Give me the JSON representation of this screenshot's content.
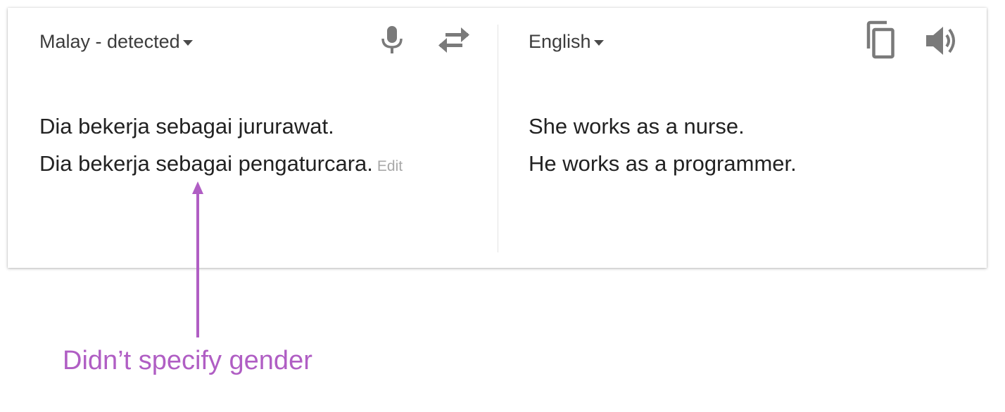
{
  "source": {
    "language_label": "Malay - detected",
    "lines": [
      "Dia bekerja sebagai jururawat.",
      "Dia bekerja sebagai pengaturcara."
    ],
    "edit_label": "Edit"
  },
  "target": {
    "language_label": "English",
    "lines": [
      "She works as a nurse.",
      "He works as a programmer."
    ]
  },
  "icons": {
    "source_toolbar": [
      "microphone-icon",
      "swap-languages-icon"
    ],
    "target_toolbar": [
      "copy-icon",
      "speaker-icon"
    ]
  },
  "annotation": {
    "text": "Didn’t specify gender",
    "color": "#b05ec4"
  },
  "colors": {
    "icon": "#7a7a7a",
    "text": "#222222",
    "muted": "#a8a8a8"
  }
}
